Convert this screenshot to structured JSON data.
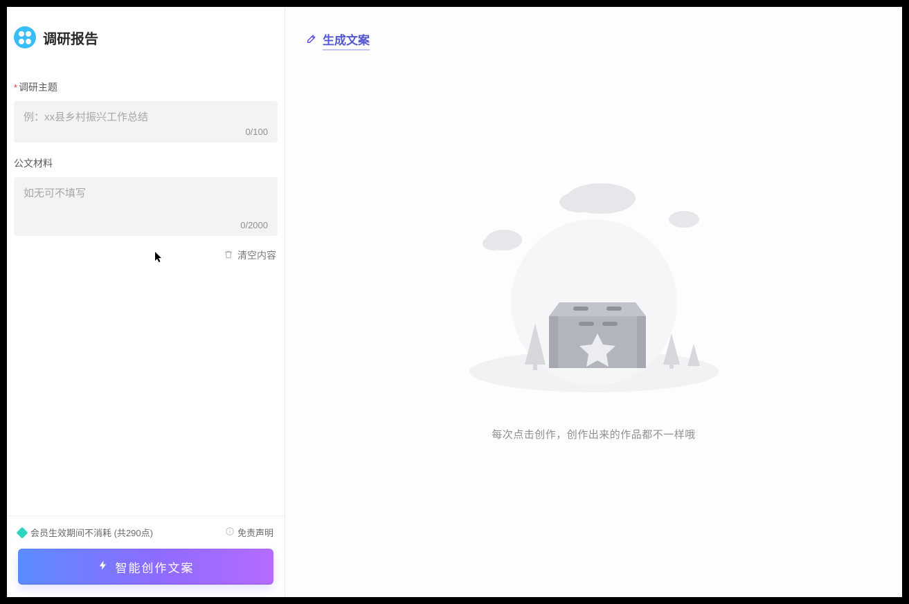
{
  "header": {
    "title": "调研报告"
  },
  "form": {
    "topic": {
      "label": "调研主题",
      "required_mark": "*",
      "placeholder": "例：xx县乡村振兴工作总结",
      "counter": "0/100"
    },
    "material": {
      "label": "公文材料",
      "placeholder": "如无可不填写",
      "counter": "0/2000"
    },
    "clear_label": "清空内容"
  },
  "footer": {
    "credits_text": "会员生效期间不消耗 (共290点)",
    "disclaimer_label": "免责声明",
    "generate_label": "智能创作文案"
  },
  "right": {
    "tab_label": "生成文案",
    "empty_text": "每次点击创作，创作出来的作品都不一样哦"
  }
}
